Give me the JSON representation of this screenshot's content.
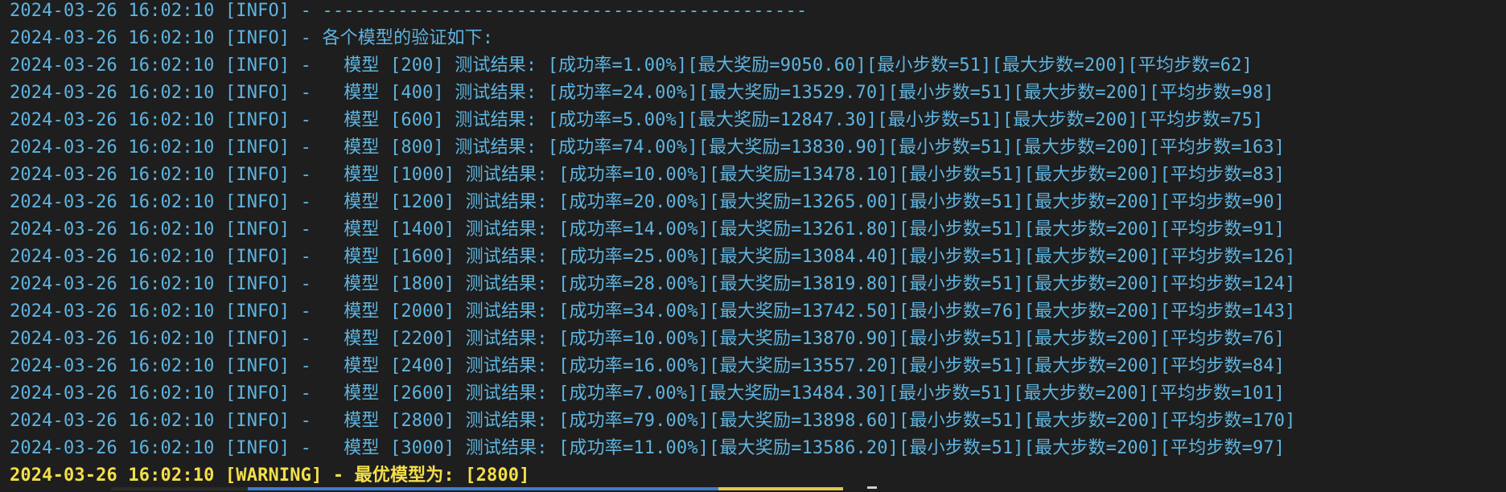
{
  "terminal": {
    "lines": [
      "2024-03-26 16:02:10 [INFO] - ---------------------------------------------",
      "2024-03-26 16:02:10 [INFO] - 各个模型的验证如下:",
      "2024-03-26 16:02:10 [INFO] -   模型 [200] 测试结果: [成功率=1.00%][最大奖励=9050.60][最小步数=51][最大步数=200][平均步数=62]",
      "2024-03-26 16:02:10 [INFO] -   模型 [400] 测试结果: [成功率=24.00%][最大奖励=13529.70][最小步数=51][最大步数=200][平均步数=98]",
      "2024-03-26 16:02:10 [INFO] -   模型 [600] 测试结果: [成功率=5.00%][最大奖励=12847.30][最小步数=51][最大步数=200][平均步数=75]",
      "2024-03-26 16:02:10 [INFO] -   模型 [800] 测试结果: [成功率=74.00%][最大奖励=13830.90][最小步数=51][最大步数=200][平均步数=163]",
      "2024-03-26 16:02:10 [INFO] -   模型 [1000] 测试结果: [成功率=10.00%][最大奖励=13478.10][最小步数=51][最大步数=200][平均步数=83]",
      "2024-03-26 16:02:10 [INFO] -   模型 [1200] 测试结果: [成功率=20.00%][最大奖励=13265.00][最小步数=51][最大步数=200][平均步数=90]",
      "2024-03-26 16:02:10 [INFO] -   模型 [1400] 测试结果: [成功率=14.00%][最大奖励=13261.80][最小步数=51][最大步数=200][平均步数=91]",
      "2024-03-26 16:02:10 [INFO] -   模型 [1600] 测试结果: [成功率=25.00%][最大奖励=13084.40][最小步数=51][最大步数=200][平均步数=126]",
      "2024-03-26 16:02:10 [INFO] -   模型 [1800] 测试结果: [成功率=28.00%][最大奖励=13819.80][最小步数=51][最大步数=200][平均步数=124]",
      "2024-03-26 16:02:10 [INFO] -   模型 [2000] 测试结果: [成功率=34.00%][最大奖励=13742.50][最小步数=76][最大步数=200][平均步数=143]",
      "2024-03-26 16:02:10 [INFO] -   模型 [2200] 测试结果: [成功率=10.00%][最大奖励=13870.90][最小步数=51][最大步数=200][平均步数=76]",
      "2024-03-26 16:02:10 [INFO] -   模型 [2400] 测试结果: [成功率=16.00%][最大奖励=13557.20][最小步数=51][最大步数=200][平均步数=84]",
      "2024-03-26 16:02:10 [INFO] -   模型 [2600] 测试结果: [成功率=7.00%][最大奖励=13484.30][最小步数=51][最大步数=200][平均步数=101]",
      "2024-03-26 16:02:10 [INFO] -   模型 [2800] 测试结果: [成功率=79.00%][最大奖励=13898.60][最小步数=51][最大步数=200][平均步数=170]",
      "2024-03-26 16:02:10 [INFO] -   模型 [3000] 测试结果: [成功率=11.00%][最大奖励=13586.20][最小步数=51][最大步数=200][平均步数=97]"
    ],
    "warning_line": "2024-03-26 16:02:10 [WARNING] - 最优模型为: [2800]"
  },
  "colors": {
    "background": "#1e1e1e",
    "info_text": "#5fb4e0",
    "warning_text": "#f3df4a"
  }
}
